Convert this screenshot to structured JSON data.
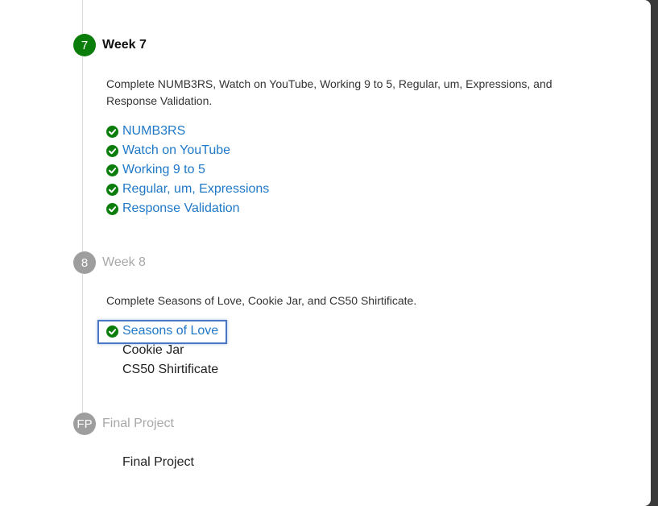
{
  "weeks": [
    {
      "badge": "7",
      "title": "Week 7",
      "description": "Complete NUMB3RS, Watch on YouTube, Working 9 to 5, Regular, um, Expressions, and Response Validation.",
      "items": [
        {
          "label": "NUMB3RS",
          "completed": true
        },
        {
          "label": "Watch on YouTube",
          "completed": true
        },
        {
          "label": "Working 9 to 5",
          "completed": true
        },
        {
          "label": "Regular, um, Expressions",
          "completed": true
        },
        {
          "label": "Response Validation",
          "completed": true
        }
      ]
    },
    {
      "badge": "8",
      "title": "Week 8",
      "description": "Complete Seasons of Love, Cookie Jar, and CS50 Shirtificate.",
      "items": [
        {
          "label": "Seasons of Love",
          "completed": true
        },
        {
          "label": "Cookie Jar",
          "completed": false
        },
        {
          "label": "CS50 Shirtificate",
          "completed": false
        }
      ]
    },
    {
      "badge": "FP",
      "title": "Final Project",
      "items": [
        {
          "label": "Final Project",
          "completed": false
        }
      ]
    }
  ],
  "colors": {
    "active_badge": "#0a7d0a",
    "inactive_badge": "#9e9e9e",
    "link": "#1f78c8",
    "check": "#0a7d0a",
    "focus_ring": "#4a78c4"
  },
  "icons": {
    "check": "check-circle-icon"
  }
}
